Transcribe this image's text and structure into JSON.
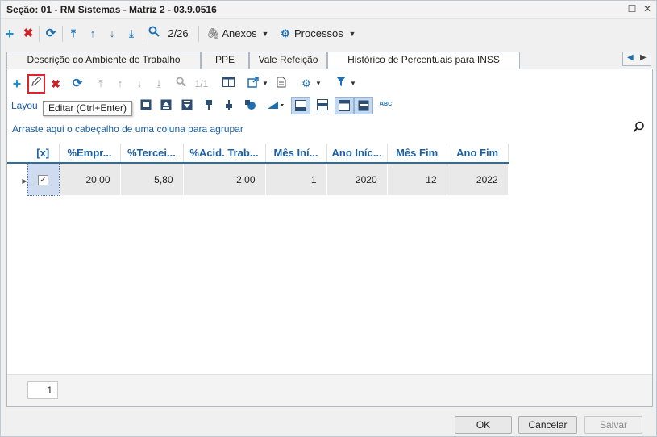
{
  "window": {
    "title": "Seção: 01 - RM Sistemas - Matriz 2 - 03.9.0516"
  },
  "main_toolbar": {
    "record_position": "2/26",
    "anexos_label": "Anexos",
    "processos_label": "Processos"
  },
  "tabs": [
    {
      "label": "Descrição do Ambiente de Trabalho",
      "active": false
    },
    {
      "label": "PPE",
      "active": false
    },
    {
      "label": "Vale Refeição",
      "active": false
    },
    {
      "label": "Histórico de Percentuais para INSS",
      "active": true
    }
  ],
  "grid_toolbar": {
    "page_indicator": "1/1",
    "layout_label": "Layou",
    "edit_tooltip": "Editar (Ctrl+Enter)"
  },
  "group_area": {
    "text": "Arraste aqui o cabeçalho de uma coluna para agrupar"
  },
  "grid": {
    "columns": [
      "[x]",
      "%Empr...",
      "%Tercei...",
      "%Acid. Trab...",
      "Mês Iní...",
      "Ano Iníc...",
      "Mês Fim",
      "Ano Fim"
    ],
    "rows": [
      {
        "checked": true,
        "cells": [
          "20,00",
          "5,80",
          "2,00",
          "1",
          "2020",
          "12",
          "2022"
        ]
      }
    ]
  },
  "footer": {
    "page_number": "1"
  },
  "buttons": {
    "ok": "OK",
    "cancel": "Cancelar",
    "save": "Salvar"
  },
  "colors": {
    "accent": "#1a5fa3",
    "highlight_red": "#d9262c",
    "add_green": "#1a8fd0"
  }
}
